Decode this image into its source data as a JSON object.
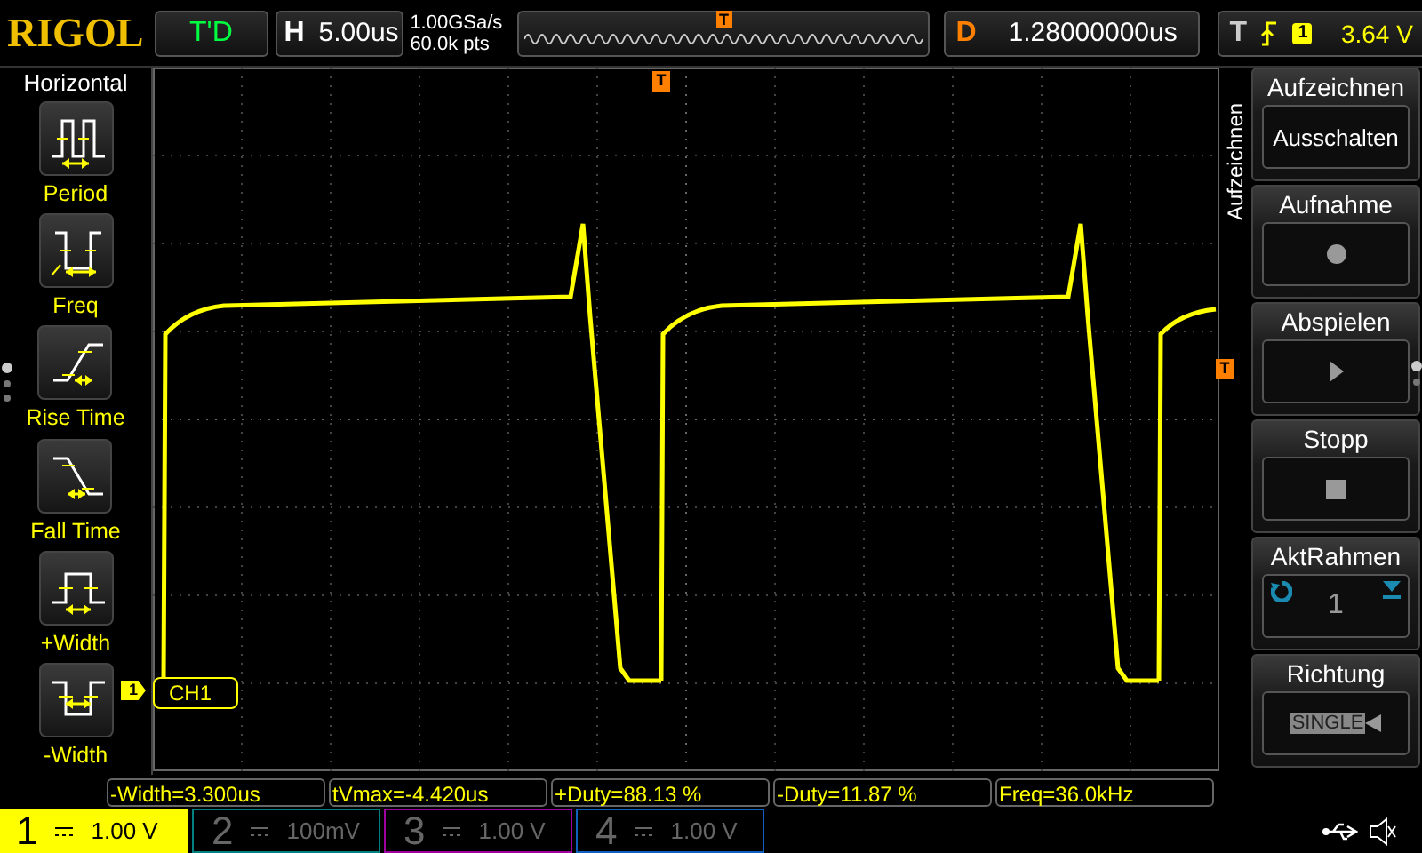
{
  "brand": "RIGOL",
  "run_state": "T'D",
  "horizontal": {
    "label": "H",
    "timebase": "5.00us",
    "sample_rate": "1.00GSa/s",
    "memory_depth": "60.0k pts",
    "trigger_marker": "T"
  },
  "delay": {
    "label": "D",
    "value": "1.28000000us"
  },
  "trigger": {
    "label": "T",
    "source": "1",
    "level": "3.64 V"
  },
  "left_menu": {
    "title": "Horizontal",
    "items": [
      {
        "label": "Period",
        "kind": "period"
      },
      {
        "label": "Freq",
        "kind": "freq"
      },
      {
        "label": "Rise Time",
        "kind": "rise"
      },
      {
        "label": "Fall Time",
        "kind": "fall"
      },
      {
        "label": "+Width",
        "kind": "pwidth"
      },
      {
        "label": "-Width",
        "kind": "nwidth"
      }
    ]
  },
  "screen": {
    "trigger_position_marker": "T",
    "trigger_level_marker": "T",
    "channel_marker": "1",
    "channel_label": "CH1"
  },
  "right_menu": {
    "title": "Aufzeichnen",
    "items": [
      {
        "title": "Aufzeichnen",
        "kind": "text",
        "value": "Ausschalten"
      },
      {
        "title": "Aufnahme",
        "kind": "record"
      },
      {
        "title": "Abspielen",
        "kind": "play"
      },
      {
        "title": "Stopp",
        "kind": "stop"
      },
      {
        "title": "AktRahmen",
        "kind": "frame",
        "value": "1"
      },
      {
        "title": "Richtung",
        "kind": "direction",
        "value": "SINGLE"
      }
    ]
  },
  "measurements": [
    "-Width=3.300us",
    "tVmax=-4.420us",
    "+Duty=88.13 %",
    "-Duty=11.87 %",
    "Freq=36.0kHz"
  ],
  "channels": [
    {
      "number": "1",
      "scale": "1.00 V",
      "color": "#ffff00",
      "on": true
    },
    {
      "number": "2",
      "scale": "100mV",
      "color": "#008080",
      "on": false
    },
    {
      "number": "3",
      "scale": "1.00 V",
      "color": "#a000a0",
      "on": false
    },
    {
      "number": "4",
      "scale": "1.00 V",
      "color": "#1060c0",
      "on": false
    }
  ]
}
